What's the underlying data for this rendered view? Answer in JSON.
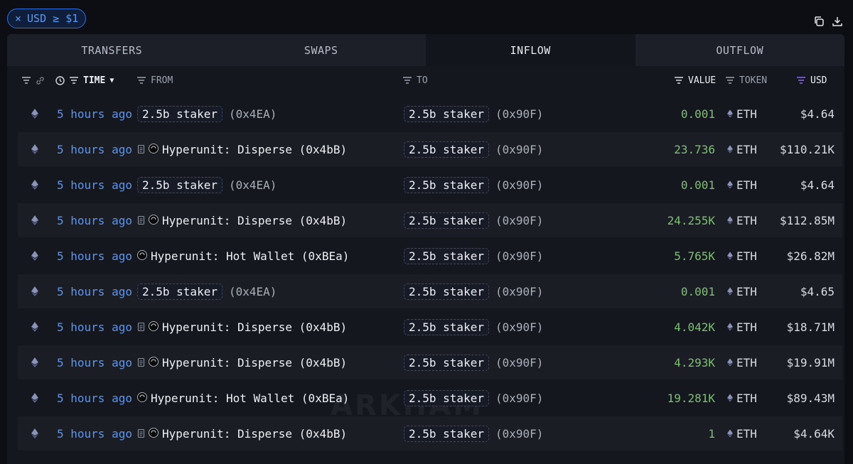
{
  "filter_chip": {
    "close_glyph": "×",
    "label": "USD ≥ $1"
  },
  "tabs": [
    {
      "label": "TRANSFERS",
      "active": false
    },
    {
      "label": "SWAPS",
      "active": false
    },
    {
      "label": "INFLOW",
      "active": true
    },
    {
      "label": "OUTFLOW",
      "active": false
    }
  ],
  "columns": {
    "time": "TIME",
    "from": "FROM",
    "to": "TO",
    "value": "VALUE",
    "token": "TOKEN",
    "usd": "USD"
  },
  "watermark": "ARKHAM",
  "colors": {
    "accent_blue": "#5e95ea",
    "value_green": "#7fbf73",
    "usd_filter_purple": "#8b6cf0"
  },
  "rows": [
    {
      "time": "5 hours ago",
      "from_name": "2.5b staker",
      "from_addr": "(0x4EA)",
      "from_type": "pill",
      "to_name": "2.5b staker",
      "to_addr": "(0x90F)",
      "value": "0.001",
      "token": "ETH",
      "usd": "$4.64"
    },
    {
      "time": "5 hours ago",
      "from_name": "Hyperunit: Disperse (0x4bB)",
      "from_addr": "",
      "from_type": "contract",
      "to_name": "2.5b staker",
      "to_addr": "(0x90F)",
      "value": "23.736",
      "token": "ETH",
      "usd": "$110.21K"
    },
    {
      "time": "5 hours ago",
      "from_name": "2.5b staker",
      "from_addr": "(0x4EA)",
      "from_type": "pill",
      "to_name": "2.5b staker",
      "to_addr": "(0x90F)",
      "value": "0.001",
      "token": "ETH",
      "usd": "$4.64"
    },
    {
      "time": "5 hours ago",
      "from_name": "Hyperunit: Disperse (0x4bB)",
      "from_addr": "",
      "from_type": "contract",
      "to_name": "2.5b staker",
      "to_addr": "(0x90F)",
      "value": "24.255K",
      "token": "ETH",
      "usd": "$112.85M"
    },
    {
      "time": "5 hours ago",
      "from_name": "Hyperunit: Hot Wallet (0xBEa)",
      "from_addr": "",
      "from_type": "entity",
      "to_name": "2.5b staker",
      "to_addr": "(0x90F)",
      "value": "5.765K",
      "token": "ETH",
      "usd": "$26.82M"
    },
    {
      "time": "5 hours ago",
      "from_name": "2.5b staker",
      "from_addr": "(0x4EA)",
      "from_type": "pill",
      "to_name": "2.5b staker",
      "to_addr": "(0x90F)",
      "value": "0.001",
      "token": "ETH",
      "usd": "$4.65"
    },
    {
      "time": "5 hours ago",
      "from_name": "Hyperunit: Disperse (0x4bB)",
      "from_addr": "",
      "from_type": "contract",
      "to_name": "2.5b staker",
      "to_addr": "(0x90F)",
      "value": "4.042K",
      "token": "ETH",
      "usd": "$18.71M"
    },
    {
      "time": "5 hours ago",
      "from_name": "Hyperunit: Disperse (0x4bB)",
      "from_addr": "",
      "from_type": "contract",
      "to_name": "2.5b staker",
      "to_addr": "(0x90F)",
      "value": "4.293K",
      "token": "ETH",
      "usd": "$19.91M"
    },
    {
      "time": "5 hours ago",
      "from_name": "Hyperunit: Hot Wallet (0xBEa)",
      "from_addr": "",
      "from_type": "entity",
      "to_name": "2.5b staker",
      "to_addr": "(0x90F)",
      "value": "19.281K",
      "token": "ETH",
      "usd": "$89.43M"
    },
    {
      "time": "5 hours ago",
      "from_name": "Hyperunit: Disperse (0x4bB)",
      "from_addr": "",
      "from_type": "contract",
      "to_name": "2.5b staker",
      "to_addr": "(0x90F)",
      "value": "1",
      "token": "ETH",
      "usd": "$4.64K"
    }
  ]
}
